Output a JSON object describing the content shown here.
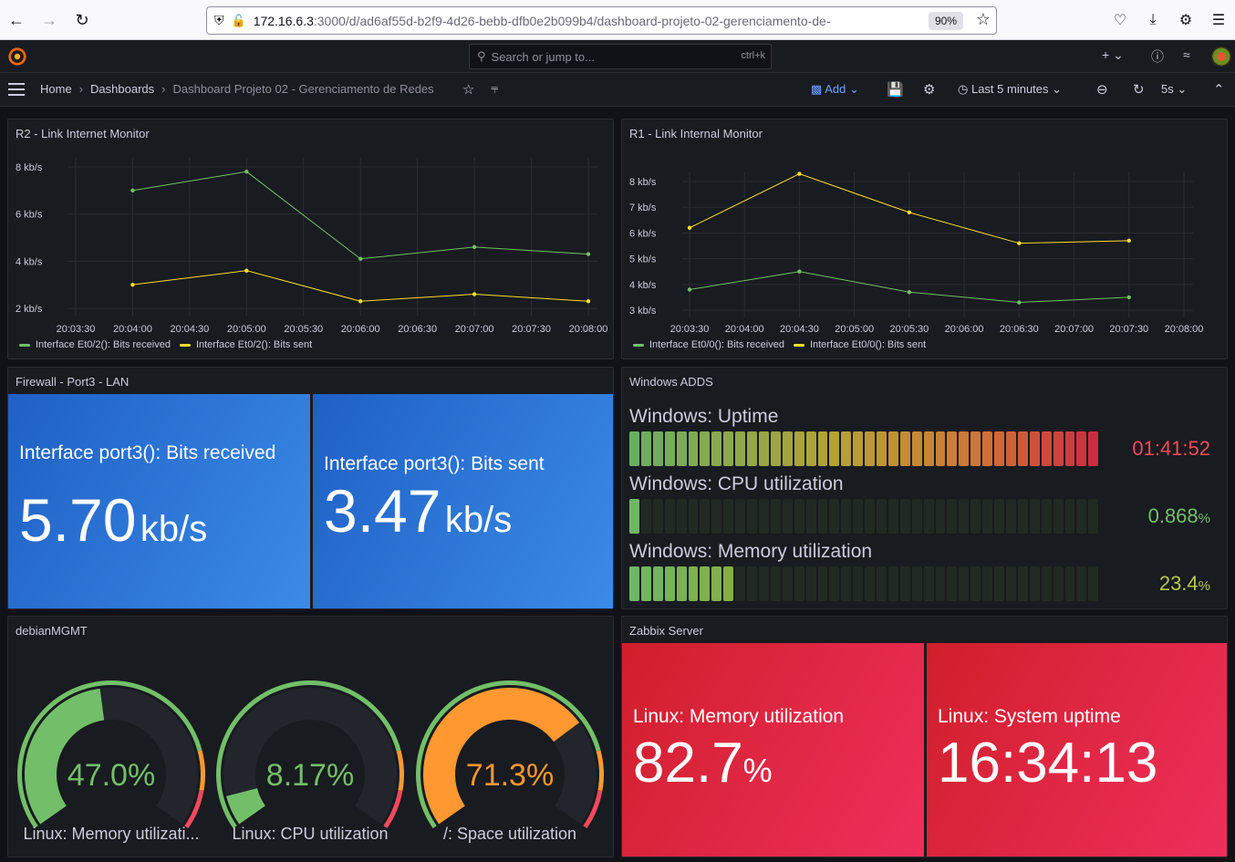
{
  "browser": {
    "url_host": "172.16.6.3",
    "url_path": ":3000/d/ad6af55d-b2f9-4d26-bebb-dfb0e2b099b4/dashboard-projeto-02-gerenciamento-de-",
    "zoom": "90%"
  },
  "topnav": {
    "search_placeholder": "Search or jump to...",
    "search_shortcut": "ctrl+k"
  },
  "breadcrumb": {
    "home": "Home",
    "dashboards": "Dashboards",
    "current": "Dashboard Projeto 02 - Gerenciamento de Redes"
  },
  "toolbar": {
    "add_label": "Add",
    "time_range": "Last 5 minutes",
    "refresh_interval": "5s"
  },
  "panels": {
    "r2": {
      "title": "R2 - Link Internet Monitor",
      "chart_data": {
        "type": "line",
        "x": [
          "20:04:00",
          "20:05:00",
          "20:06:00",
          "20:07:00",
          "20:08:00"
        ],
        "x_ticks": [
          "20:03:30",
          "20:04:00",
          "20:04:30",
          "20:05:00",
          "20:05:30",
          "20:06:00",
          "20:06:30",
          "20:07:00",
          "20:07:30",
          "20:08:00"
        ],
        "y_ticks": [
          "2 kb/s",
          "4 kb/s",
          "6 kb/s",
          "8 kb/s"
        ],
        "ylim": [
          2,
          8
        ],
        "series": [
          {
            "name": "Interface Et0/2(): Bits received",
            "color": "#73bf69",
            "values": [
              7.0,
              7.8,
              4.1,
              4.6,
              4.3
            ]
          },
          {
            "name": "Interface Et0/2(): Bits sent",
            "color": "#fade2a",
            "values": [
              3.0,
              3.6,
              2.3,
              2.6,
              2.3
            ]
          }
        ]
      }
    },
    "r1": {
      "title": "R1 - Link Internal Monitor",
      "chart_data": {
        "type": "line",
        "x": [
          "20:03:30",
          "20:04:30",
          "20:05:30",
          "20:06:30",
          "20:07:30"
        ],
        "x_ticks": [
          "20:03:30",
          "20:04:00",
          "20:04:30",
          "20:05:00",
          "20:05:30",
          "20:06:00",
          "20:06:30",
          "20:07:00",
          "20:07:30",
          "20:08:00"
        ],
        "y_ticks": [
          "3 kb/s",
          "4 kb/s",
          "5 kb/s",
          "6 kb/s",
          "7 kb/s",
          "8 kb/s"
        ],
        "ylim": [
          3,
          8
        ],
        "series": [
          {
            "name": "Interface Et0/0(): Bits received",
            "color": "#73bf69",
            "values": [
              3.8,
              4.5,
              3.7,
              3.3,
              3.5
            ]
          },
          {
            "name": "Interface Et0/0(): Bits sent",
            "color": "#fade2a",
            "values": [
              6.2,
              8.3,
              6.8,
              5.6,
              5.7
            ]
          }
        ]
      }
    },
    "firewall": {
      "title": "Firewall - Port3 - LAN",
      "stats": [
        {
          "label": "Interface port3(): Bits received",
          "value": "5.70",
          "unit": "kb/s"
        },
        {
          "label": "Interface port3(): Bits sent",
          "value": "3.47",
          "unit": "kb/s"
        }
      ]
    },
    "adds": {
      "title": "Windows ADDS",
      "bars": [
        {
          "label": "Windows: Uptime",
          "value": "01:41:52",
          "unit": "",
          "fill": 1.0,
          "value_color": "#f2495c",
          "mode": "gradient"
        },
        {
          "label": "Windows: CPU utilization",
          "value": "0.868",
          "unit": "%",
          "fill": 0.01,
          "value_color": "#73bf69",
          "mode": "green"
        },
        {
          "label": "Windows: Memory utilization",
          "value": "23.4",
          "unit": "%",
          "fill": 0.234,
          "value_color": "#b7c64c",
          "mode": "green"
        }
      ]
    },
    "debian": {
      "title": "debianMGMT",
      "gauges": [
        {
          "label": "Linux: Memory utilizati...",
          "value": "47.0%",
          "fraction": 0.47,
          "color": "#73bf69"
        },
        {
          "label": "Linux: CPU utilization",
          "value": "8.17%",
          "fraction": 0.0817,
          "color": "#73bf69"
        },
        {
          "label": "/: Space utilization",
          "value": "71.3%",
          "fraction": 0.713,
          "color": "#ff9830"
        }
      ]
    },
    "zabbix": {
      "title": "Zabbix Server",
      "stats": [
        {
          "label": "Linux: Memory utilization",
          "value": "82.7",
          "unit": "%"
        },
        {
          "label": "Linux: System uptime",
          "value": "16:34:13",
          "unit": ""
        }
      ]
    }
  }
}
